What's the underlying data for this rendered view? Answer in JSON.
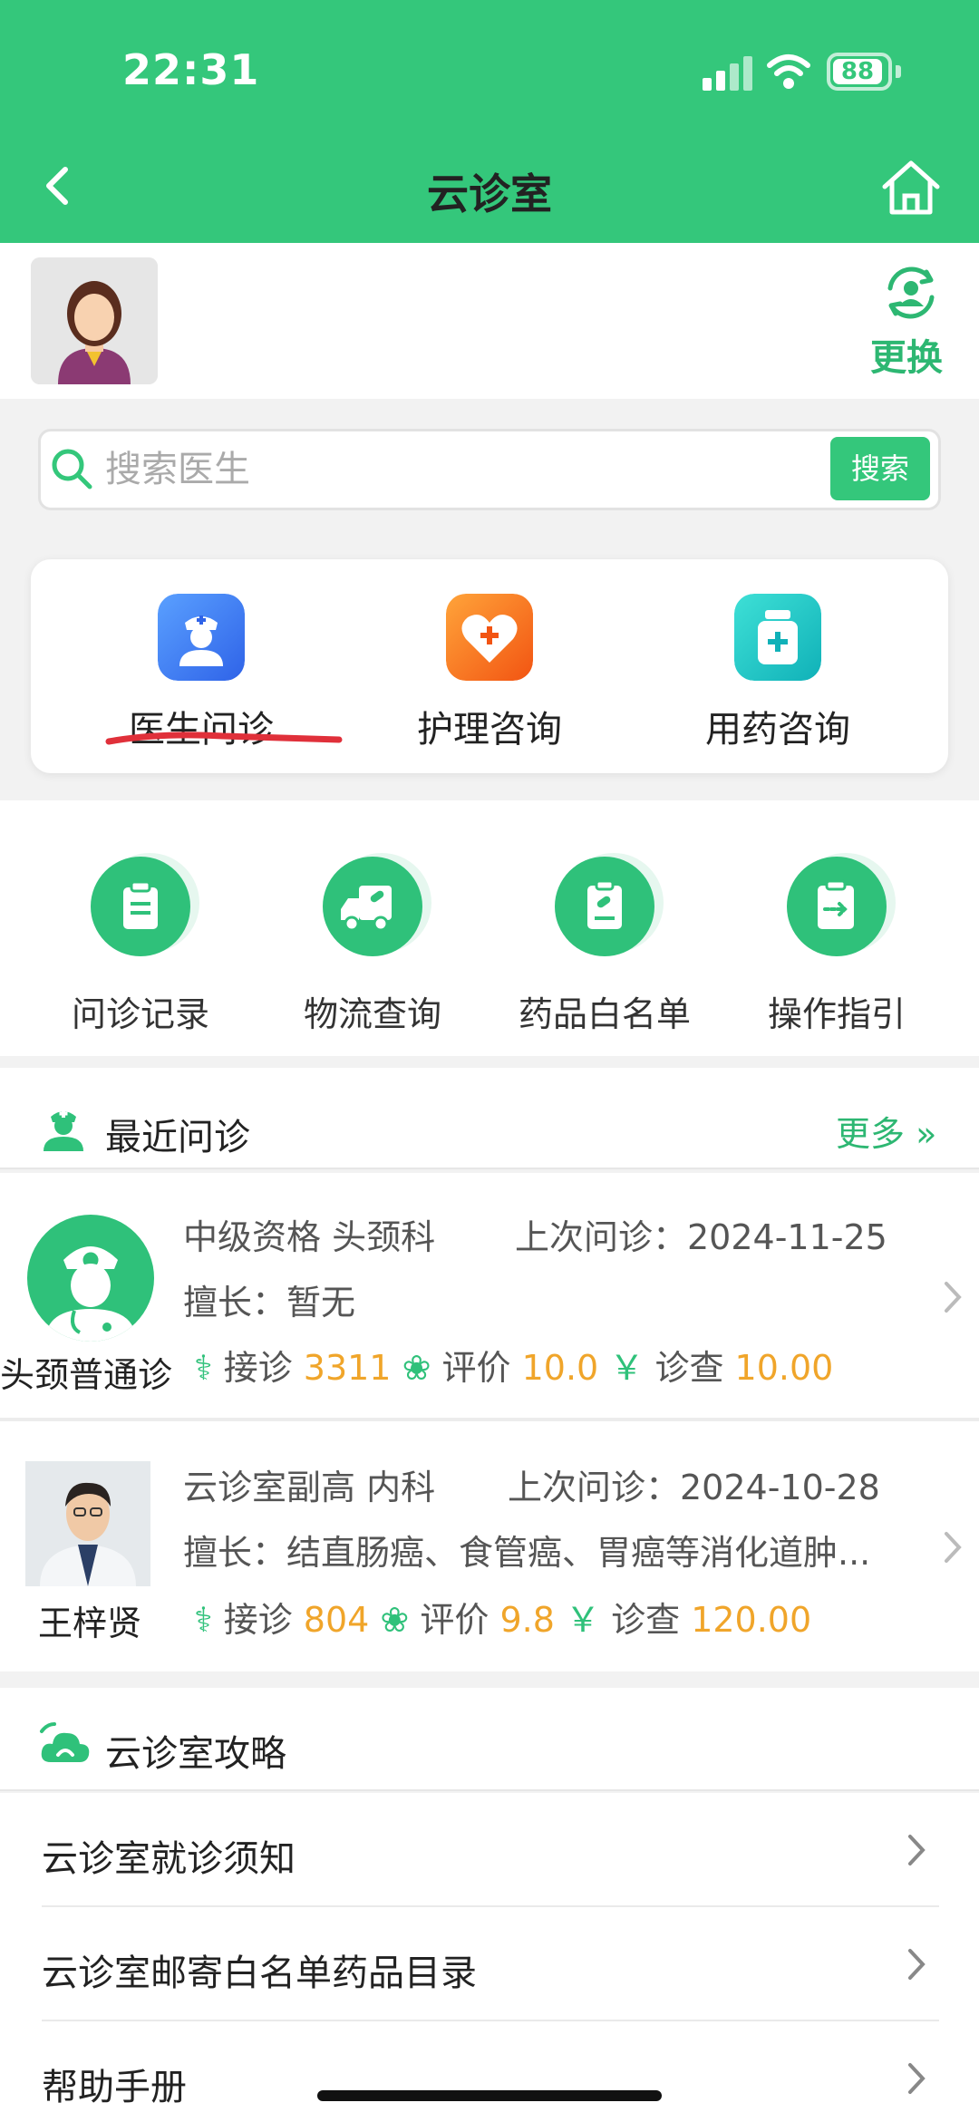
{
  "status_bar": {
    "time": "22:31",
    "battery": "88"
  },
  "nav": {
    "title": "云诊室"
  },
  "profile": {
    "switch_label": "更换"
  },
  "search": {
    "placeholder": "搜索医生",
    "button": "搜索"
  },
  "services": [
    {
      "label": "医生问诊",
      "icon": "nurse-icon",
      "color": "#3d7cf7"
    },
    {
      "label": "护理咨询",
      "icon": "heart-plus-icon",
      "color": "#f56a1f"
    },
    {
      "label": "用药咨询",
      "icon": "medicine-bottle-icon",
      "color": "#1cc4c4"
    }
  ],
  "tools": [
    {
      "label": "问诊记录",
      "icon": "clipboard-icon"
    },
    {
      "label": "物流查询",
      "icon": "delivery-truck-icon"
    },
    {
      "label": "药品白名单",
      "icon": "medicine-list-icon"
    },
    {
      "label": "操作指引",
      "icon": "guide-icon"
    }
  ],
  "recent": {
    "title": "最近问诊",
    "more": "更多",
    "doctors": [
      {
        "name": "头颈普通诊",
        "title_dept": "中级资格 头颈科",
        "last_visit": "上次问诊：2024-11-25",
        "specialty": "擅长：暂无",
        "visits_label": "接诊",
        "visits": "3311",
        "rating_label": "评价",
        "rating": "10.0",
        "fee_label": "诊查",
        "fee": "10.00",
        "currency": "￥"
      },
      {
        "name": "王梓贤",
        "title_dept": "云诊室副高 内科",
        "last_visit": "上次问诊：2024-10-28",
        "specialty": "擅长：结直肠癌、食管癌、胃癌等消化道肿...",
        "visits_label": "接诊",
        "visits": "804",
        "rating_label": "评价",
        "rating": "9.8",
        "fee_label": "诊查",
        "fee": "120.00",
        "currency": "￥"
      }
    ]
  },
  "guide": {
    "title": "云诊室攻略",
    "items": [
      "云诊室就诊须知",
      "云诊室邮寄白名单药品目录",
      "帮助手册"
    ]
  },
  "colors": {
    "brand": "#34c77b",
    "accent_orange": "#f0a52a"
  }
}
